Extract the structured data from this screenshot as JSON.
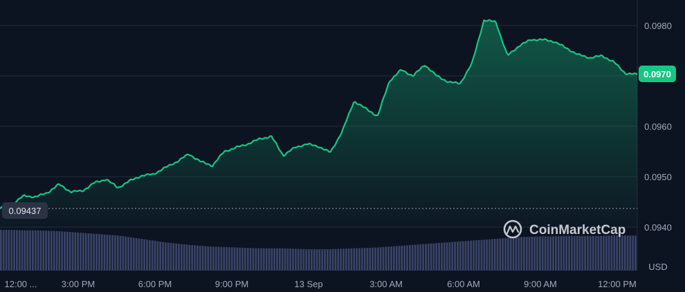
{
  "chart_data": {
    "type": "area",
    "title": "",
    "xlabel": "",
    "ylabel": "",
    "currency_label": "USD",
    "ylim": [
      0.0935,
      0.0985
    ],
    "y_ticks": [
      "0.0940",
      "0.0950",
      "0.0960",
      "0.0970",
      "0.0980"
    ],
    "x_ticks": [
      "12:00 ...",
      "3:00 PM",
      "6:00 PM",
      "9:00 PM",
      "13 Sep",
      "3:00 AM",
      "6:00 AM",
      "9:00 AM",
      "12:00 PM"
    ],
    "open_price_label": "0.09437",
    "current_price_label": "0.0970",
    "grid": true,
    "watermark": "CoinMarketCap",
    "colors": {
      "line": "#16c784",
      "background": "#0d1421",
      "grid": "#222a3a",
      "volume": "#3a4468",
      "current_badge": "#16c784",
      "open_badge": "#2b3244"
    },
    "series": [
      {
        "x_hours": [
          0,
          0.5,
          1,
          1.5,
          2,
          2.5,
          3,
          3.5,
          4,
          4.5,
          5,
          5.5,
          6,
          6.5,
          7,
          7.5,
          8,
          8.5,
          9,
          9.5,
          10,
          10.5,
          11,
          11.5,
          12,
          12.5,
          13,
          13.5,
          14,
          14.5,
          15,
          15.5,
          16,
          16.5,
          17,
          17.5,
          18,
          18.5,
          19,
          19.5,
          20,
          20.5,
          21,
          21.5,
          22,
          22.5,
          23,
          23.5,
          24,
          24.5,
          25,
          25.5,
          26,
          26.5,
          27
        ],
        "values": [
          0.09437,
          0.09445,
          0.09462,
          0.0946,
          0.09468,
          0.09485,
          0.0947,
          0.09472,
          0.09488,
          0.09495,
          0.09478,
          0.09492,
          0.09502,
          0.09505,
          0.09518,
          0.0953,
          0.09545,
          0.0953,
          0.09522,
          0.0955,
          0.09558,
          0.09565,
          0.09575,
          0.0958,
          0.09542,
          0.09558,
          0.09565,
          0.0956,
          0.09548,
          0.0959,
          0.0965,
          0.09635,
          0.0962,
          0.0969,
          0.09712,
          0.097,
          0.09722,
          0.097,
          0.09688,
          0.09685,
          0.09725,
          0.0981,
          0.09808,
          0.0974,
          0.0976,
          0.09772,
          0.09772,
          0.09768,
          0.09755,
          0.09742,
          0.09736,
          0.0974,
          0.09728,
          0.09705,
          0.09703
        ],
        "volume_relative": [
          0.95,
          0.95,
          0.94,
          0.94,
          0.93,
          0.92,
          0.9,
          0.88,
          0.86,
          0.84,
          0.82,
          0.78,
          0.74,
          0.7,
          0.66,
          0.63,
          0.6,
          0.58,
          0.56,
          0.55,
          0.54,
          0.53,
          0.52,
          0.52,
          0.52,
          0.51,
          0.5,
          0.5,
          0.5,
          0.51,
          0.52,
          0.53,
          0.54,
          0.56,
          0.58,
          0.6,
          0.62,
          0.64,
          0.66,
          0.68,
          0.7,
          0.72,
          0.74,
          0.76,
          0.78,
          0.79,
          0.8,
          0.8,
          0.81,
          0.81,
          0.81,
          0.81,
          0.82,
          0.82,
          0.82
        ]
      }
    ]
  }
}
